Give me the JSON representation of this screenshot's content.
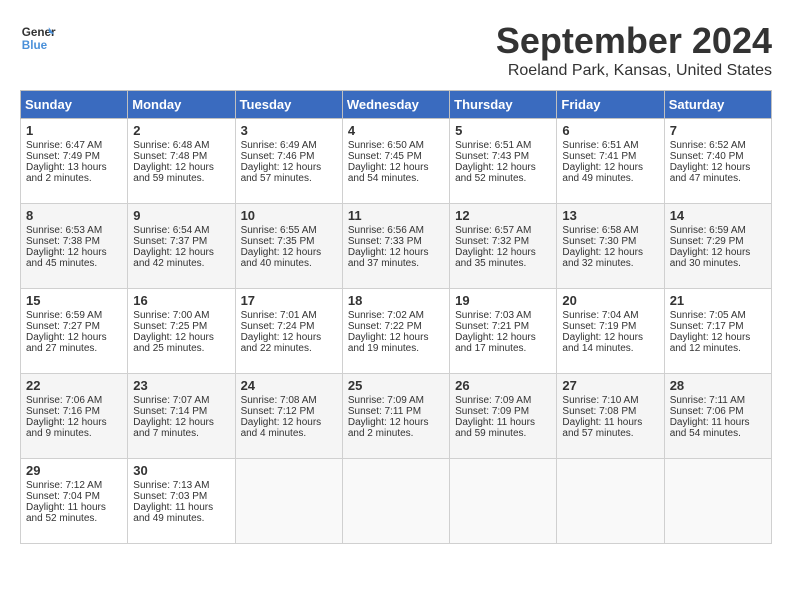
{
  "header": {
    "logo_line1": "General",
    "logo_line2": "Blue",
    "month": "September 2024",
    "location": "Roeland Park, Kansas, United States"
  },
  "days_of_week": [
    "Sunday",
    "Monday",
    "Tuesday",
    "Wednesday",
    "Thursday",
    "Friday",
    "Saturday"
  ],
  "weeks": [
    [
      {
        "day": 1,
        "info": "Sunrise: 6:47 AM\nSunset: 7:49 PM\nDaylight: 13 hours\nand 2 minutes."
      },
      {
        "day": 2,
        "info": "Sunrise: 6:48 AM\nSunset: 7:48 PM\nDaylight: 12 hours\nand 59 minutes."
      },
      {
        "day": 3,
        "info": "Sunrise: 6:49 AM\nSunset: 7:46 PM\nDaylight: 12 hours\nand 57 minutes."
      },
      {
        "day": 4,
        "info": "Sunrise: 6:50 AM\nSunset: 7:45 PM\nDaylight: 12 hours\nand 54 minutes."
      },
      {
        "day": 5,
        "info": "Sunrise: 6:51 AM\nSunset: 7:43 PM\nDaylight: 12 hours\nand 52 minutes."
      },
      {
        "day": 6,
        "info": "Sunrise: 6:51 AM\nSunset: 7:41 PM\nDaylight: 12 hours\nand 49 minutes."
      },
      {
        "day": 7,
        "info": "Sunrise: 6:52 AM\nSunset: 7:40 PM\nDaylight: 12 hours\nand 47 minutes."
      }
    ],
    [
      {
        "day": 8,
        "info": "Sunrise: 6:53 AM\nSunset: 7:38 PM\nDaylight: 12 hours\nand 45 minutes."
      },
      {
        "day": 9,
        "info": "Sunrise: 6:54 AM\nSunset: 7:37 PM\nDaylight: 12 hours\nand 42 minutes."
      },
      {
        "day": 10,
        "info": "Sunrise: 6:55 AM\nSunset: 7:35 PM\nDaylight: 12 hours\nand 40 minutes."
      },
      {
        "day": 11,
        "info": "Sunrise: 6:56 AM\nSunset: 7:33 PM\nDaylight: 12 hours\nand 37 minutes."
      },
      {
        "day": 12,
        "info": "Sunrise: 6:57 AM\nSunset: 7:32 PM\nDaylight: 12 hours\nand 35 minutes."
      },
      {
        "day": 13,
        "info": "Sunrise: 6:58 AM\nSunset: 7:30 PM\nDaylight: 12 hours\nand 32 minutes."
      },
      {
        "day": 14,
        "info": "Sunrise: 6:59 AM\nSunset: 7:29 PM\nDaylight: 12 hours\nand 30 minutes."
      }
    ],
    [
      {
        "day": 15,
        "info": "Sunrise: 6:59 AM\nSunset: 7:27 PM\nDaylight: 12 hours\nand 27 minutes."
      },
      {
        "day": 16,
        "info": "Sunrise: 7:00 AM\nSunset: 7:25 PM\nDaylight: 12 hours\nand 25 minutes."
      },
      {
        "day": 17,
        "info": "Sunrise: 7:01 AM\nSunset: 7:24 PM\nDaylight: 12 hours\nand 22 minutes."
      },
      {
        "day": 18,
        "info": "Sunrise: 7:02 AM\nSunset: 7:22 PM\nDaylight: 12 hours\nand 19 minutes."
      },
      {
        "day": 19,
        "info": "Sunrise: 7:03 AM\nSunset: 7:21 PM\nDaylight: 12 hours\nand 17 minutes."
      },
      {
        "day": 20,
        "info": "Sunrise: 7:04 AM\nSunset: 7:19 PM\nDaylight: 12 hours\nand 14 minutes."
      },
      {
        "day": 21,
        "info": "Sunrise: 7:05 AM\nSunset: 7:17 PM\nDaylight: 12 hours\nand 12 minutes."
      }
    ],
    [
      {
        "day": 22,
        "info": "Sunrise: 7:06 AM\nSunset: 7:16 PM\nDaylight: 12 hours\nand 9 minutes."
      },
      {
        "day": 23,
        "info": "Sunrise: 7:07 AM\nSunset: 7:14 PM\nDaylight: 12 hours\nand 7 minutes."
      },
      {
        "day": 24,
        "info": "Sunrise: 7:08 AM\nSunset: 7:12 PM\nDaylight: 12 hours\nand 4 minutes."
      },
      {
        "day": 25,
        "info": "Sunrise: 7:09 AM\nSunset: 7:11 PM\nDaylight: 12 hours\nand 2 minutes."
      },
      {
        "day": 26,
        "info": "Sunrise: 7:09 AM\nSunset: 7:09 PM\nDaylight: 11 hours\nand 59 minutes."
      },
      {
        "day": 27,
        "info": "Sunrise: 7:10 AM\nSunset: 7:08 PM\nDaylight: 11 hours\nand 57 minutes."
      },
      {
        "day": 28,
        "info": "Sunrise: 7:11 AM\nSunset: 7:06 PM\nDaylight: 11 hours\nand 54 minutes."
      }
    ],
    [
      {
        "day": 29,
        "info": "Sunrise: 7:12 AM\nSunset: 7:04 PM\nDaylight: 11 hours\nand 52 minutes."
      },
      {
        "day": 30,
        "info": "Sunrise: 7:13 AM\nSunset: 7:03 PM\nDaylight: 11 hours\nand 49 minutes."
      },
      null,
      null,
      null,
      null,
      null
    ]
  ]
}
